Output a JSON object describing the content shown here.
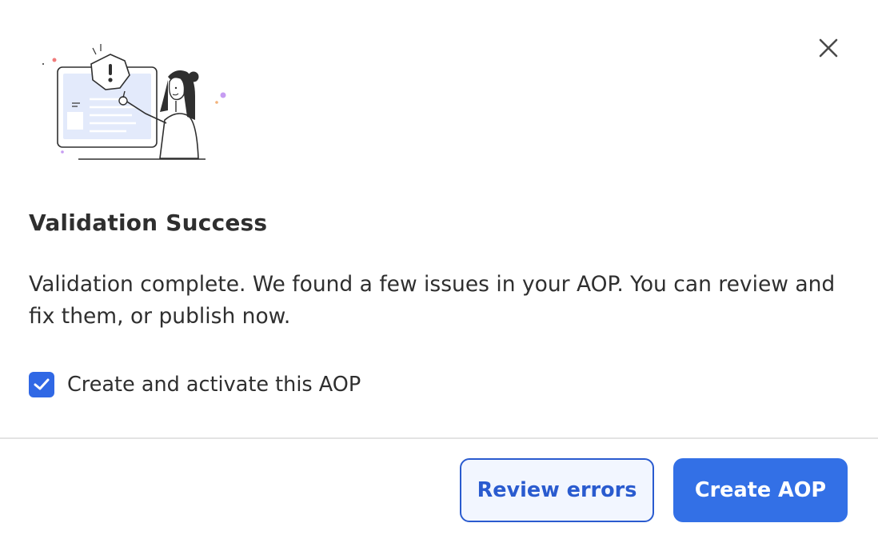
{
  "dialog": {
    "title": "Validation Success",
    "message": "Validation complete. We found a few issues in your AOP. You can review and fix them, or publish now.",
    "close_icon": "close-icon",
    "illustration_icon": "warning-illustration"
  },
  "checkbox": {
    "label": "Create and activate this AOP",
    "checked": true,
    "icon": "checkmark-icon"
  },
  "actions": {
    "secondary_label": "Review errors",
    "primary_label": "Create AOP"
  },
  "colors": {
    "accent": "#3370e6",
    "secondary_border": "#2a5bcf",
    "secondary_bg": "#f2f6ff",
    "illustration_screen": "#e6ecfb"
  }
}
